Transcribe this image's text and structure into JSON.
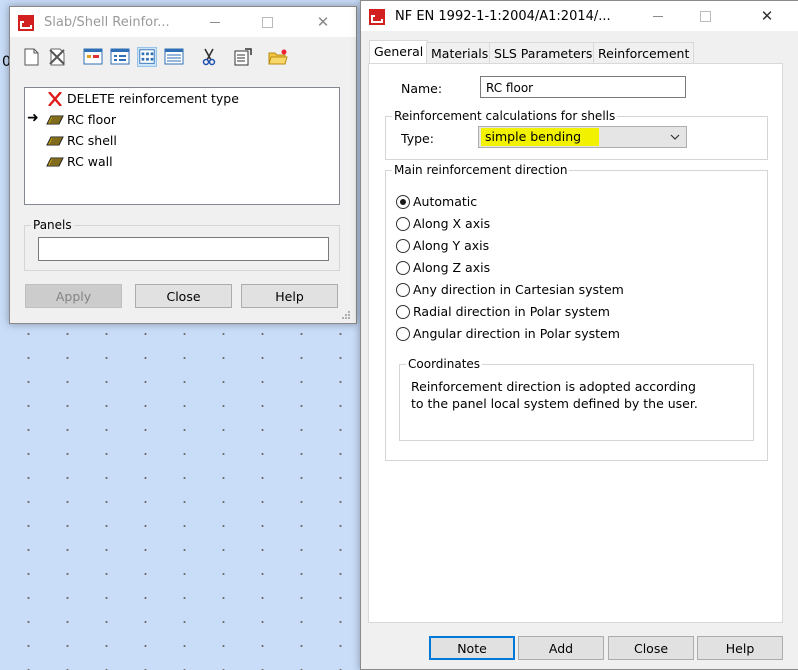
{
  "canvas": {
    "edge_char": "0"
  },
  "left_window": {
    "title": "Slab/Shell Reinfor...",
    "toolbar": [
      "new-icon",
      "delete-icon",
      "view-icon-1",
      "view-icon-2",
      "view-icon-3",
      "view-icon-4",
      "cut-icon",
      "properties-icon",
      "open-folder-icon"
    ],
    "items": [
      {
        "label": "DELETE reinforcement type",
        "icon": "delete-x-icon"
      },
      {
        "label": "RC floor",
        "icon": "slab-icon",
        "current": true
      },
      {
        "label": "RC shell",
        "icon": "slab-icon"
      },
      {
        "label": "RC wall",
        "icon": "slab-icon"
      }
    ],
    "panels_label": "Panels",
    "panels_value": "",
    "buttons": {
      "apply": "Apply",
      "close": "Close",
      "help": "Help"
    }
  },
  "right_window": {
    "title": "NF EN 1992-1-1:2004/A1:2014/...",
    "tabs": [
      "General",
      "Materials",
      "SLS Parameters",
      "Reinforcement"
    ],
    "active_tab": "General",
    "name_label": "Name:",
    "name_value": "RC floor",
    "calc_group": "Reinforcement calculations for shells",
    "type_label": "Type:",
    "type_value": "simple bending",
    "highlight_color": "#f2f200",
    "direction_group": "Main reinforcement direction",
    "directions": [
      {
        "label": "Automatic",
        "checked": true
      },
      {
        "label": "Along X axis",
        "checked": false
      },
      {
        "label": "Along Y axis",
        "checked": false
      },
      {
        "label": "Along Z axis",
        "checked": false
      },
      {
        "label": "Any direction in Cartesian system",
        "checked": false
      },
      {
        "label": "Radial direction in Polar system",
        "checked": false
      },
      {
        "label": "Angular direction in Polar system",
        "checked": false
      }
    ],
    "coordinates_group": "Coordinates",
    "coordinates_text_1": "Reinforcement direction is adopted according",
    "coordinates_text_2": "to the panel local system defined by the user.",
    "buttons": {
      "note": "Note",
      "add": "Add",
      "close": "Close",
      "help": "Help"
    }
  }
}
